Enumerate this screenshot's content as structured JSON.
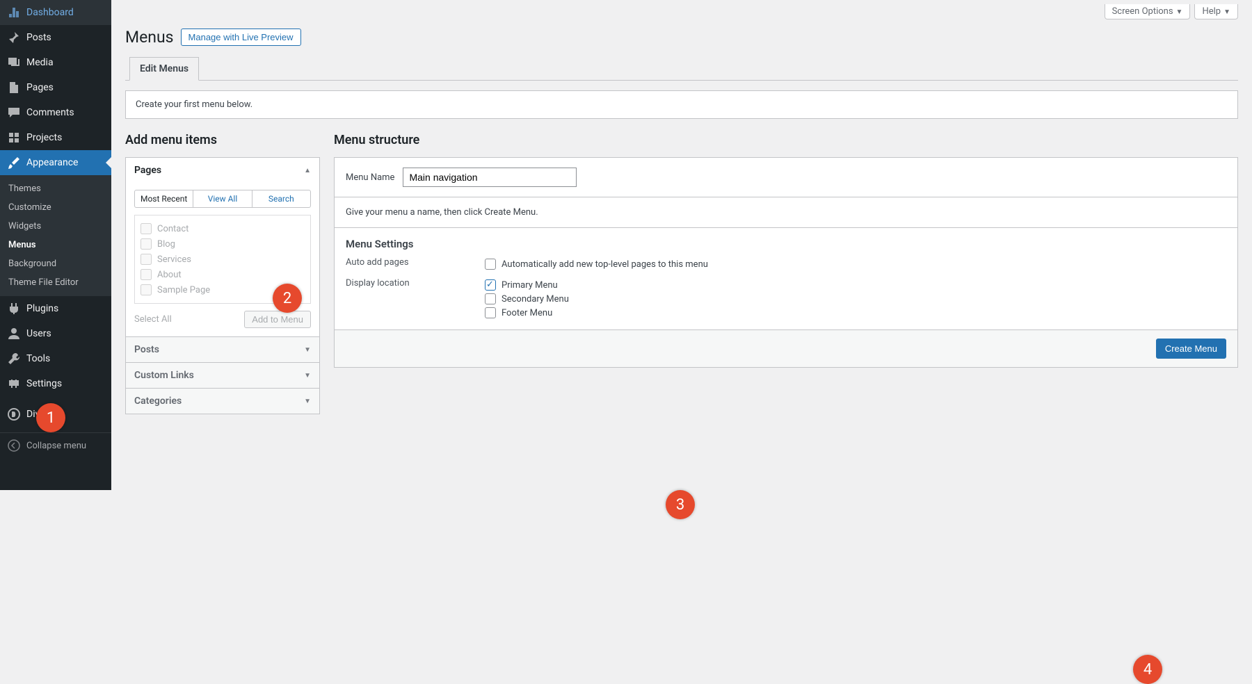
{
  "sidebar": {
    "items": [
      {
        "icon": "dashboard",
        "label": "Dashboard"
      },
      {
        "icon": "pin",
        "label": "Posts"
      },
      {
        "icon": "media",
        "label": "Media"
      },
      {
        "icon": "page",
        "label": "Pages"
      },
      {
        "icon": "comment",
        "label": "Comments"
      },
      {
        "icon": "projects",
        "label": "Projects"
      },
      {
        "icon": "brush",
        "label": "Appearance"
      }
    ],
    "appearance_sub": [
      "Themes",
      "Customize",
      "Widgets",
      "Menus",
      "Background",
      "Theme File Editor"
    ],
    "after": [
      {
        "icon": "plugin",
        "label": "Plugins"
      },
      {
        "icon": "user",
        "label": "Users"
      },
      {
        "icon": "tool",
        "label": "Tools"
      },
      {
        "icon": "gear",
        "label": "Settings"
      },
      {
        "icon": "divi",
        "label": "Divi"
      }
    ],
    "collapse": "Collapse menu"
  },
  "top": {
    "screen_options": "Screen Options",
    "help": "Help"
  },
  "header": {
    "title": "Menus",
    "live_preview": "Manage with Live Preview"
  },
  "tabs": {
    "edit": "Edit Menus"
  },
  "notice": "Create your first menu below.",
  "left": {
    "heading": "Add menu items",
    "pages_box": {
      "title": "Pages",
      "tabs": [
        "Most Recent",
        "View All",
        "Search"
      ],
      "items": [
        "Contact",
        "Blog",
        "Services",
        "About",
        "Sample Page"
      ],
      "select_all": "Select All",
      "add_btn": "Add to Menu"
    },
    "posts_box": "Posts",
    "links_box": "Custom Links",
    "cats_box": "Categories"
  },
  "right": {
    "heading": "Menu structure",
    "name_label": "Menu Name",
    "name_value": "Main navigation",
    "hint": "Give your menu a name, then click Create Menu.",
    "settings_title": "Menu Settings",
    "auto_label": "Auto add pages",
    "auto_opt": "Automatically add new top-level pages to this menu",
    "loc_label": "Display location",
    "loc_opts": [
      "Primary Menu",
      "Secondary Menu",
      "Footer Menu"
    ],
    "create_btn": "Create Menu"
  },
  "badges": [
    "1",
    "2",
    "3",
    "4"
  ]
}
